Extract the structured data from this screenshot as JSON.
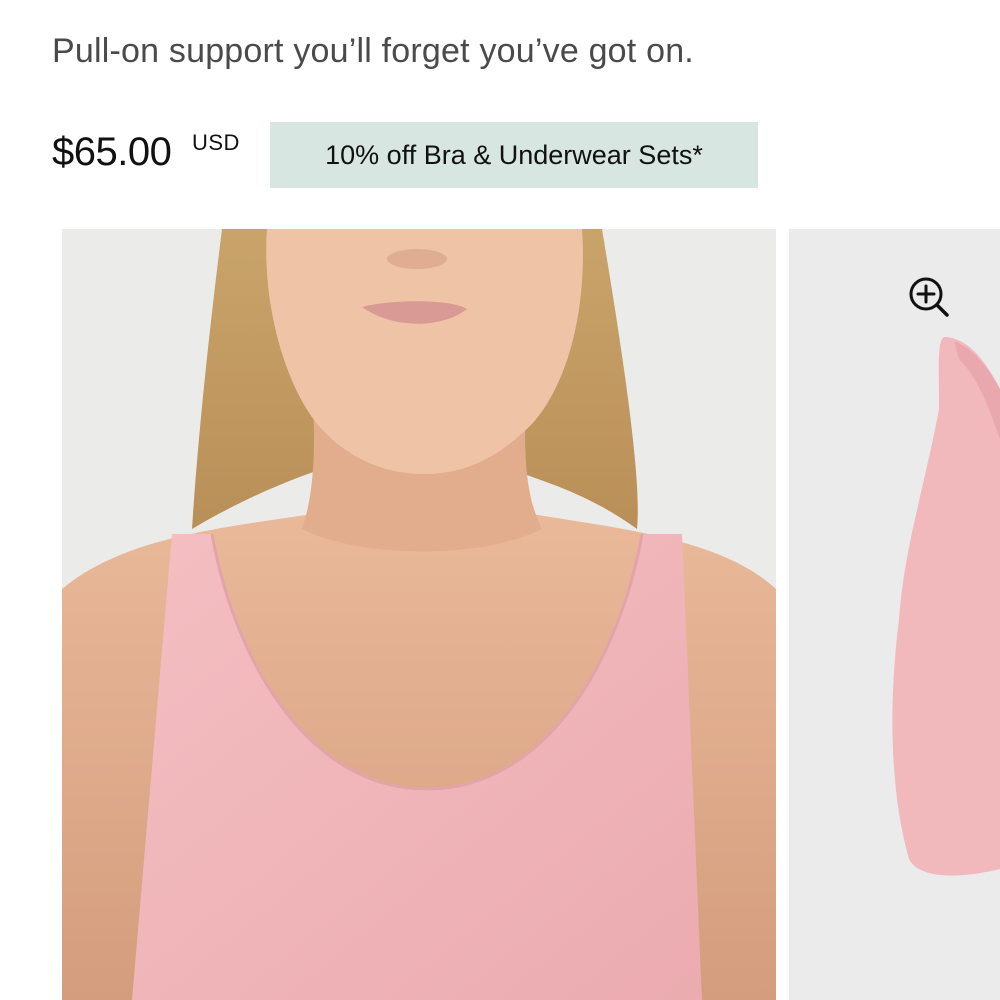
{
  "product": {
    "subtitle": "Pull-on support you’ll forget you’ve got on.",
    "price": "$65.00",
    "currency": "USD",
    "promo": "10% off Bra & Underwear Sets*"
  },
  "gallery": {
    "slide_count_visible": 2,
    "zoom_icon": "zoom-in-icon"
  },
  "colors": {
    "promo_background": "#d7e6e1",
    "product_pink": "#f2b9bc",
    "gallery_background": "#ebebea"
  }
}
